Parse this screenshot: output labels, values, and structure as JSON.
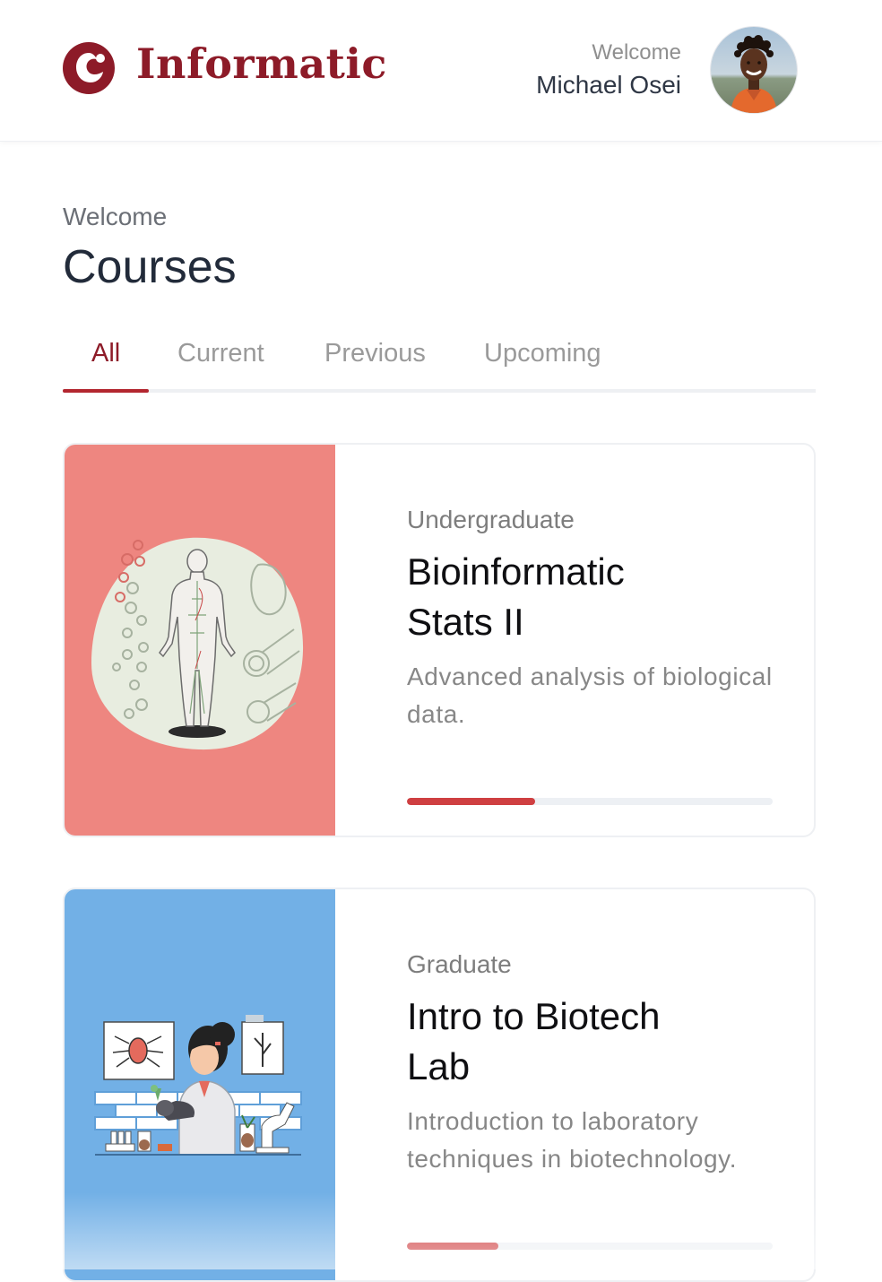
{
  "brand": {
    "name": "Informatic",
    "color": "#8d1b28"
  },
  "user": {
    "welcome": "Welcome",
    "name": "Michael Osei",
    "avatar_icon": "user-avatar"
  },
  "page": {
    "subtitle": "Welcome",
    "title": "Courses"
  },
  "tabs": [
    {
      "label": "All",
      "active": true
    },
    {
      "label": "Current",
      "active": false
    },
    {
      "label": "Previous",
      "active": false
    },
    {
      "label": "Upcoming",
      "active": false
    }
  ],
  "courses": [
    {
      "level": "Undergraduate",
      "title": "Bioinformatic Stats II",
      "description": "Advanced analysis of biological data.",
      "progress": 0.35,
      "image_bg": "#ee8680",
      "image_icon": "human-anatomy-illustration"
    },
    {
      "level": "Graduate",
      "title": "Intro to Biotech Lab",
      "description": "Introduction to laboratory techniques in biotechnology.",
      "progress": 0.25,
      "image_bg": "#72b0e6",
      "image_icon": "lab-scientist-illustration"
    }
  ],
  "colors": {
    "accent": "#b3262f",
    "progress": "#cf3f41",
    "track": "#edf0f4"
  }
}
